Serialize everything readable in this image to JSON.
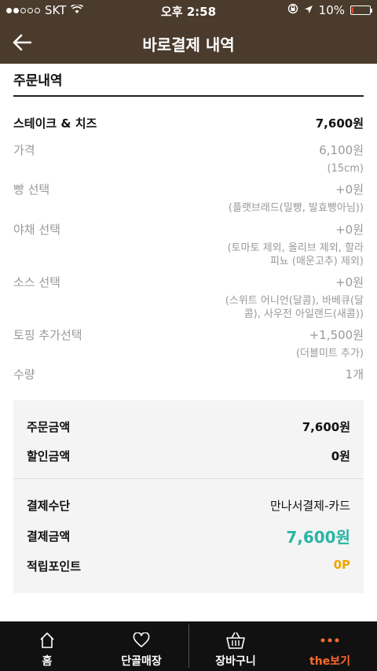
{
  "status_bar": {
    "carrier": "SKT",
    "time": "오후 2:58",
    "battery": "10%",
    "battery_level": 0.1
  },
  "header": {
    "title": "바로결제 내역",
    "back_icon": "arrow-left-icon"
  },
  "order": {
    "section_title": "주문내역",
    "item_name": "스테이크 & 치즈",
    "item_price": "7,600원",
    "rows": [
      {
        "label": "가격",
        "value": "6,100원",
        "detail": "(15cm)"
      },
      {
        "label": "빵 선택",
        "value": "+0원",
        "detail": "(플랫브래드(밀빵, 발효빵아님))"
      },
      {
        "label": "야채 선택",
        "value": "+0원",
        "detail_lines": [
          "(토마토 제외, 올리브 제외, 할라",
          "피뇨 (매운고추) 제외)"
        ]
      },
      {
        "label": "소스 선택",
        "value": "+0원",
        "detail_lines": [
          "(스위트 어니언(달콤), 바베큐(달",
          "콤), 사우전 아일랜드(새콤))"
        ]
      },
      {
        "label": "토핑 추가선택",
        "value": "+1,500원",
        "detail": "(더블미트 추가)"
      },
      {
        "label": "수량",
        "value": "1개"
      }
    ]
  },
  "summary": {
    "order_amount_label": "주문금액",
    "order_amount": "7,600원",
    "discount_label": "할인금액",
    "discount": "0원",
    "payment_method_label": "결제수단",
    "payment_method": "만나서결제-카드",
    "payment_amount_label": "결제금액",
    "payment_amount": "7,600원",
    "points_label": "적립포인트",
    "points": "0P",
    "accent_color": "#2ab5a5",
    "points_color": "#f0a500"
  },
  "bottom_nav": [
    {
      "label": "홈",
      "icon": "home-icon"
    },
    {
      "label": "단골매장",
      "icon": "heart-icon"
    },
    {
      "label": "장바구니",
      "icon": "basket-icon"
    },
    {
      "label": "the보기",
      "icon": "more-dots-icon",
      "active": true
    }
  ],
  "colors": {
    "header_bg": "#4a3b2c",
    "active_tab": "#ff6a2b"
  }
}
